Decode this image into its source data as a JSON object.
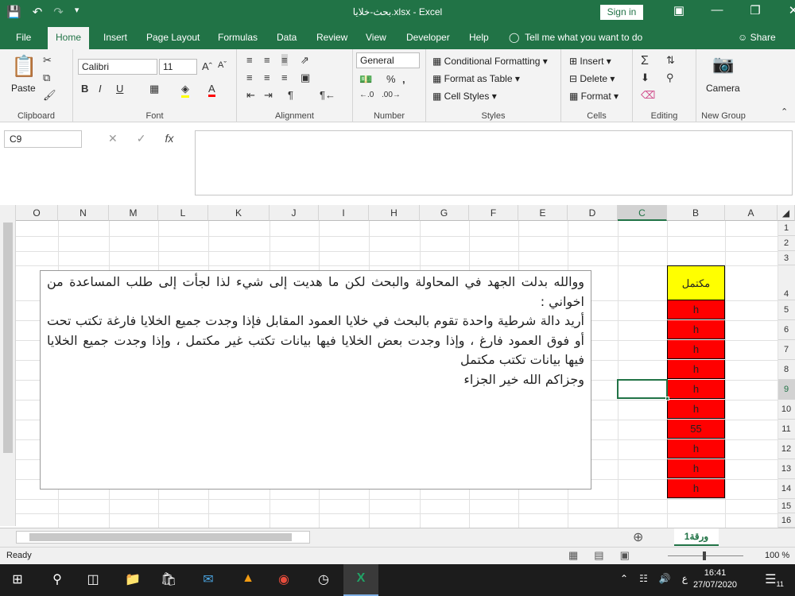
{
  "window": {
    "title": "بحث-خلايا.xlsx  -  Excel",
    "signin": "Sign in"
  },
  "tabs": {
    "file": "File",
    "home": "Home",
    "insert": "Insert",
    "page_layout": "Page Layout",
    "formulas": "Formulas",
    "data": "Data",
    "review": "Review",
    "view": "View",
    "developer": "Developer",
    "help": "Help",
    "tell_me": "Tell me what you want to do",
    "share": "Share"
  },
  "ribbon": {
    "clipboard": {
      "label": "Clipboard",
      "paste": "Paste"
    },
    "font": {
      "label": "Font",
      "name": "Calibri",
      "size": "11"
    },
    "alignment": {
      "label": "Alignment"
    },
    "number": {
      "label": "Number",
      "format": "General"
    },
    "styles": {
      "label": "Styles",
      "conditional": "Conditional Formatting",
      "table": "Format as Table",
      "cell_styles": "Cell Styles"
    },
    "cells": {
      "label": "Cells",
      "insert": "Insert",
      "delete": "Delete",
      "format": "Format"
    },
    "editing": {
      "label": "Editing"
    },
    "newgroup": {
      "label": "New Group",
      "camera": "Camera"
    }
  },
  "formula_bar": {
    "name_box": "C9",
    "value": ""
  },
  "grid": {
    "columns": [
      "O",
      "N",
      "M",
      "L",
      "K",
      "J",
      "I",
      "H",
      "G",
      "F",
      "E",
      "D",
      "C",
      "B",
      "A"
    ],
    "selected_column": "C",
    "rows": [
      "1",
      "2",
      "3",
      "4",
      "5",
      "6",
      "7",
      "8",
      "9",
      "10",
      "11",
      "12",
      "13",
      "14",
      "15",
      "16"
    ],
    "selected_row": "9",
    "header_cell": "مكتمل",
    "b_values": [
      "h",
      "h",
      "h",
      "h",
      "h",
      "h",
      "55",
      "h",
      "h",
      "h"
    ]
  },
  "textbox": {
    "p1": "ووالله بدلت الجهد في المحاولة والبحث لكن ما هديت إلى شيء لذا لجأت إلى طلب المساعدة من اخواني :",
    "p2": "أريد دالة شرطية واحدة تقوم بالبحث في خلايا العمود المقابل فإذا وجدت جميع الخلايا فارغة تكتب تحت أو فوق العمود فارغ ، وإذا وجدت بعض الخلايا فيها بيانات تكتب غير مكتمل ، وإذا وجدت جميع الخلايا فيها بيانات تكتب مكتمل",
    "p3": "وجزاكم الله خير الجزاء"
  },
  "sheet": {
    "tab": "ورقة1"
  },
  "status": {
    "ready": "Ready",
    "zoom": "100 %"
  },
  "taskbar": {
    "time": "16:41",
    "date": "27/07/2020",
    "lang": "ع",
    "notifications": "11"
  },
  "colors": {
    "excel_green": "#217346",
    "header_yellow": "#ffff00",
    "cell_red": "#ff0000"
  }
}
